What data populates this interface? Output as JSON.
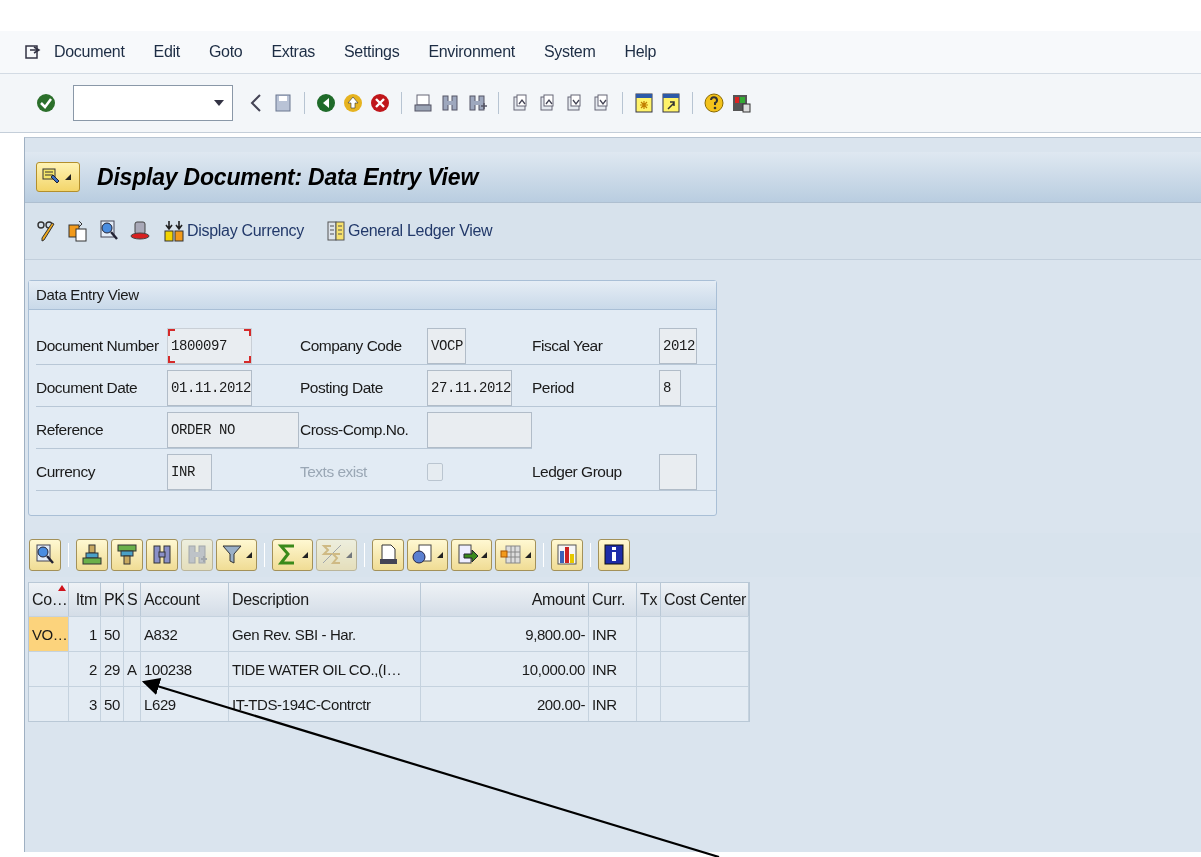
{
  "menu_bar": {
    "items": [
      {
        "label": "Document"
      },
      {
        "label": "Edit"
      },
      {
        "label": "Goto"
      },
      {
        "label": "Extras"
      },
      {
        "label": "Settings"
      },
      {
        "label": "Environment"
      },
      {
        "label": "System"
      },
      {
        "label": "Help"
      }
    ]
  },
  "title": "Display Document: Data Entry View",
  "application_toolbar": {
    "buttons": [
      {
        "label": "Display Currency"
      },
      {
        "label": "General Ledger View"
      }
    ]
  },
  "data_entry_view": {
    "title": "Data Entry View",
    "rows": [
      [
        {
          "label": "Document Number",
          "kind": "input",
          "value": "1800097",
          "focused": true,
          "disabled": false
        },
        {
          "label": "Company Code",
          "kind": "input",
          "value": "VOCP",
          "focused": false,
          "disabled": false
        },
        {
          "label": "Fiscal Year",
          "kind": "input",
          "value": "2012",
          "focused": false,
          "disabled": false
        }
      ],
      [
        {
          "label": "Document Date",
          "kind": "input",
          "value": "01.11.2012",
          "focused": false,
          "disabled": false
        },
        {
          "label": "Posting Date",
          "kind": "input",
          "value": "27.11.2012",
          "focused": false,
          "disabled": false
        },
        {
          "label": "Period",
          "kind": "input",
          "value": "8",
          "focused": false,
          "disabled": false
        }
      ],
      [
        {
          "label": "Reference",
          "kind": "input",
          "value": "ORDER NO",
          "focused": false,
          "disabled": false
        },
        {
          "label": "Cross-Comp.No.",
          "kind": "input",
          "focused": false,
          "disabled": false
        }
      ],
      [
        {
          "label": "Currency",
          "kind": "input",
          "value": "INR",
          "focused": false,
          "disabled": false
        },
        {
          "label": "Texts exist",
          "kind": "checkbox",
          "checked": false,
          "disabled": true
        },
        {
          "label": "Ledger Group",
          "kind": "input",
          "focused": false,
          "disabled": false
        }
      ]
    ]
  },
  "table": {
    "columns": [
      {
        "label": "Co…",
        "sorted": true
      },
      {
        "label": "Itm",
        "sorted": false
      },
      {
        "label": "PK",
        "sorted": false
      },
      {
        "label": "S",
        "sorted": false
      },
      {
        "label": "Account",
        "sorted": false
      },
      {
        "label": "Description",
        "sorted": false
      },
      {
        "label": "Amount",
        "sorted": false
      },
      {
        "label": "Curr.",
        "sorted": false
      },
      {
        "label": "Tx",
        "sorted": false
      },
      {
        "label": "Cost Center",
        "sorted": false
      }
    ],
    "rows": [
      {
        "company": "VO…",
        "item": "1",
        "posting_key": "50",
        "account": "A832",
        "description": "Gen Rev. SBI - Har.",
        "amount": "9,800.00-",
        "currency": "INR"
      },
      {
        "item": "2",
        "posting_key": "29",
        "special": "A",
        "account": "100238",
        "description": "TIDE WATER OIL CO.,(I…",
        "amount": "10,000.00",
        "currency": "INR"
      },
      {
        "item": "3",
        "posting_key": "50",
        "account": "L629",
        "description": "IT-TDS-194C-Contrctr",
        "amount": "200.00-",
        "currency": "INR"
      }
    ]
  }
}
